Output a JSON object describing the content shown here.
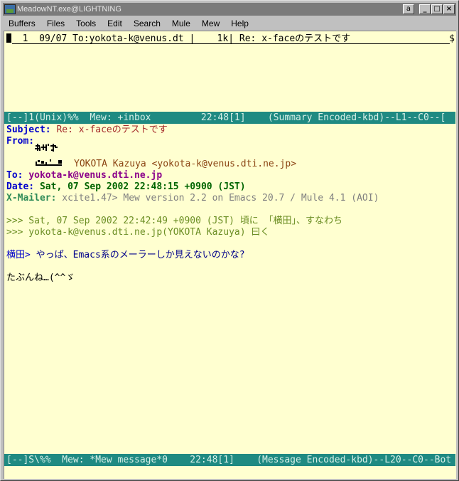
{
  "window": {
    "title": "MeadowNT.exe@LIGHTNING",
    "ime_button": "a",
    "minimize_label": "_",
    "maximize_label": "□",
    "close_label": "×"
  },
  "menu": [
    "Buffers",
    "Files",
    "Tools",
    "Edit",
    "Search",
    "Mule",
    "Mew",
    "Help"
  ],
  "summary": {
    "line": "  1  09/07 To:yokota-k@venus.dt |    1k| Re: x-faceのテストです",
    "continuation": "$"
  },
  "modeline_top": "[--]1(Unix)%%  Mew: +inbox         22:48[1]    (Summary Encoded-kbd)--L1--C0--[",
  "message": {
    "subject_label": "Subject:",
    "subject_value": "Re: x-faceのテストです",
    "from_label": "From:",
    "from_value": "YOKOTA Kazuya <yokota-k@venus.dti.ne.jp>",
    "to_label": "To:",
    "to_value": "yokota-k@venus.dti.ne.jp",
    "date_label": "Date:",
    "date_value": "Sat, 07 Sep 2002 22:48:15 +0900 (JST)",
    "xmailer_label": "X-Mailer:",
    "xmailer_value": "xcite1.47> Mew version 2.2 on Emacs 20.7 / Mule 4.1 (AOI)",
    "cite1": ">>> Sat, 07 Sep 2002 22:42:49 +0900 (JST) 頃に 「横田」、すなわち",
    "cite2": ">>> yokota-k@venus.dti.ne.jp(YOKOTA Kazuya) 曰く",
    "quote_prefix": "横田>",
    "quote_text": " やっぱ、Emacs系のメーラーしか見えないのかな?",
    "reply": "たぶんね…(^^ゞ"
  },
  "modeline_bottom": "[--]S\\%%  Mew: *Mew message*0    22:48[1]    (Message Encoded-kbd)--L20--C0--Bot"
}
